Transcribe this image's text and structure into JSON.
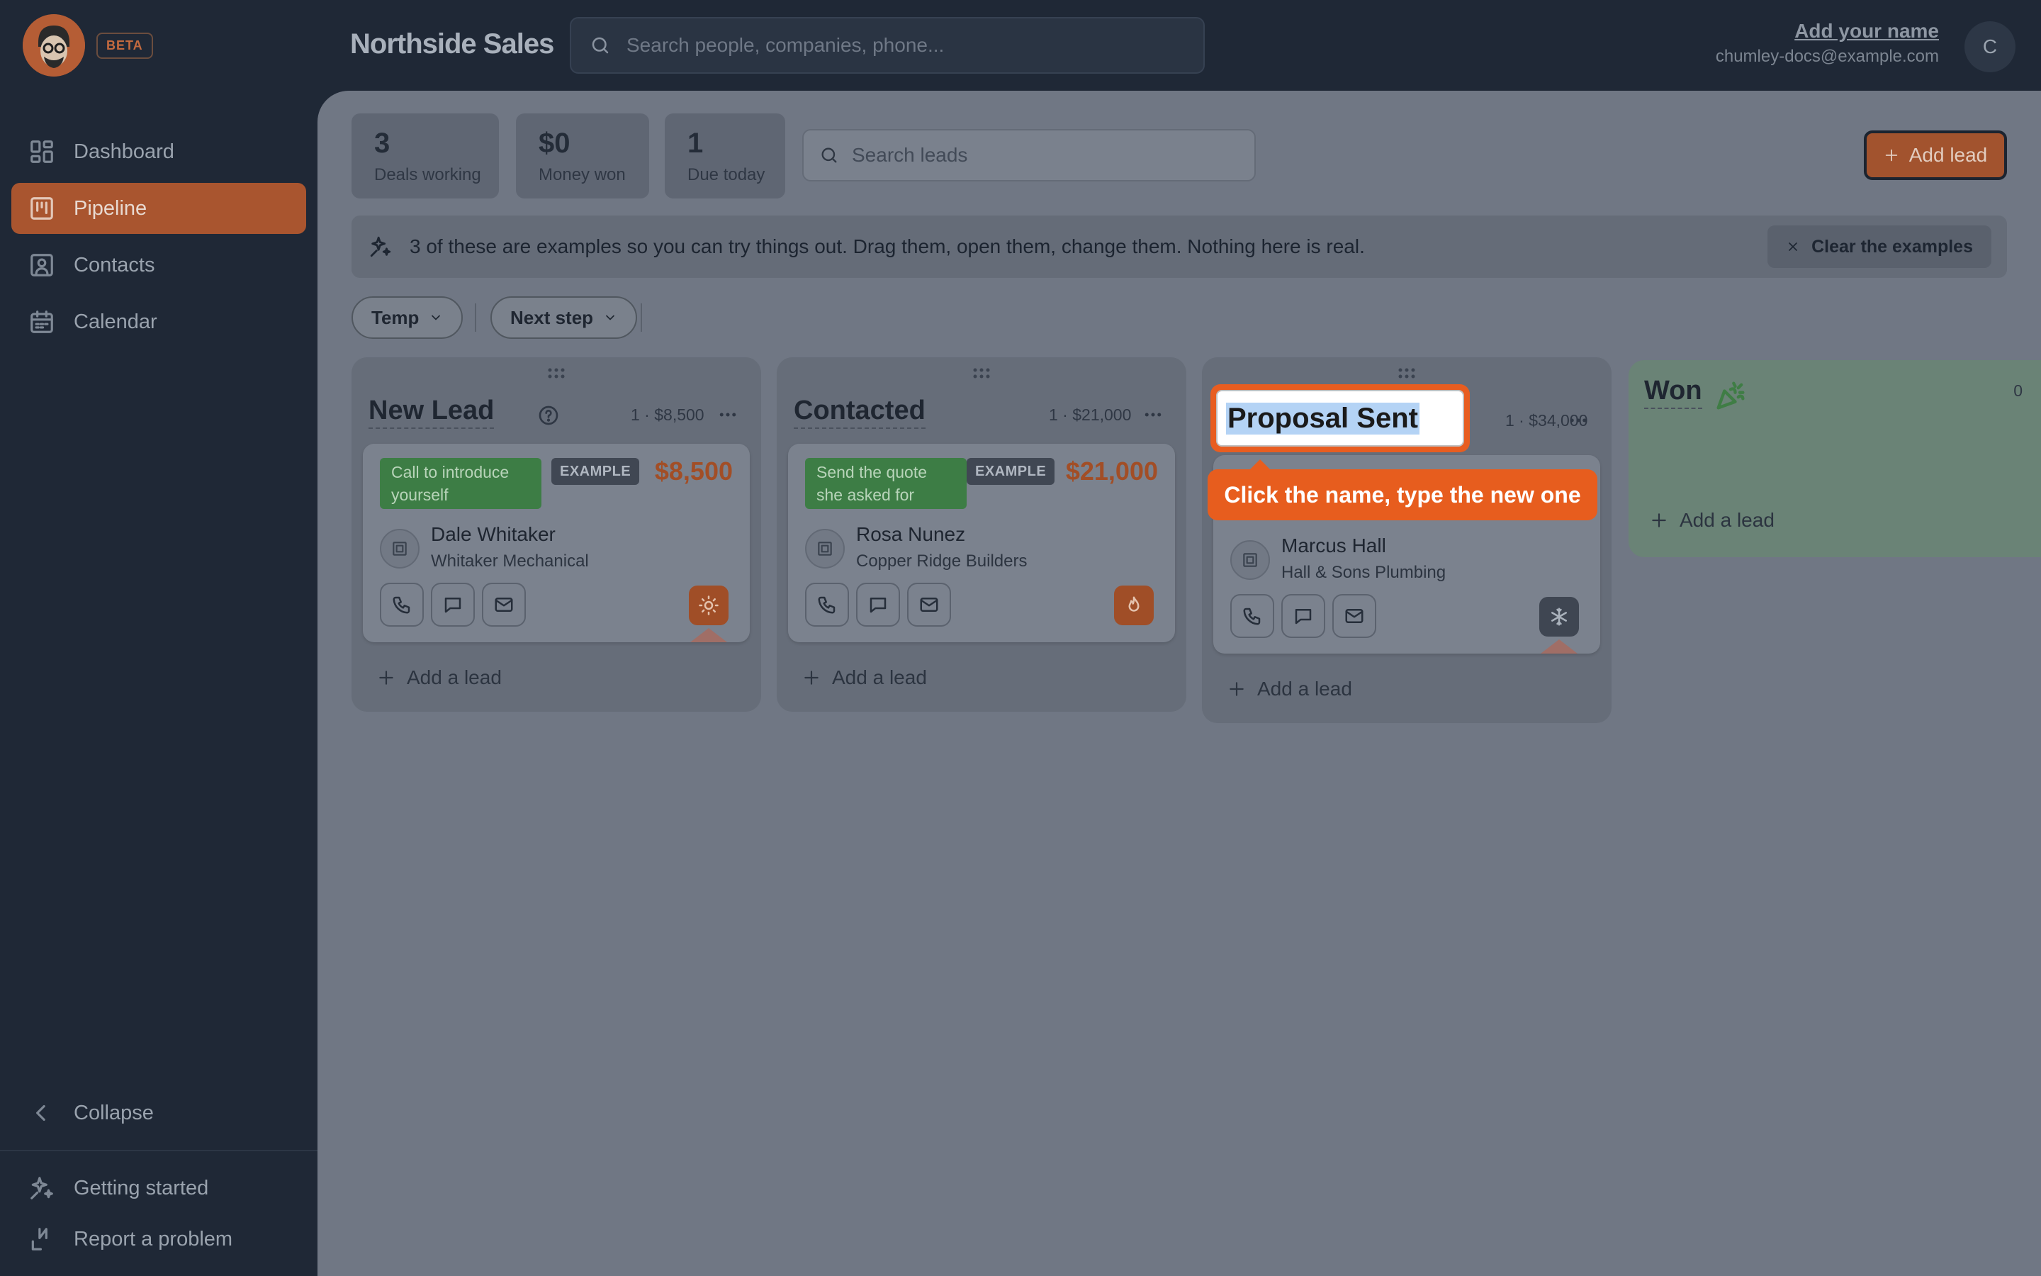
{
  "app": {
    "beta_label": "BETA",
    "title": "Northside Sales"
  },
  "header": {
    "search_placeholder": "Search people, companies, phone...",
    "user_name": "Add your name",
    "user_email": "chumley-docs@example.com",
    "avatar_initial": "C"
  },
  "sidebar": {
    "items": [
      {
        "label": "Dashboard",
        "icon": "dashboard-icon",
        "active": false
      },
      {
        "label": "Pipeline",
        "icon": "pipeline-icon",
        "active": true
      },
      {
        "label": "Contacts",
        "icon": "contacts-icon",
        "active": false
      },
      {
        "label": "Calendar",
        "icon": "calendar-icon",
        "active": false
      }
    ],
    "collapse_label": "Collapse",
    "getting_started_label": "Getting started",
    "report_label": "Report a problem"
  },
  "stats": [
    {
      "value": "3",
      "label": "Deals working"
    },
    {
      "value": "$0",
      "label": "Money won"
    },
    {
      "value": "1",
      "label": "Due today"
    }
  ],
  "leads_search_placeholder": "Search leads",
  "add_lead_label": "Add lead",
  "banner": {
    "text": "3 of these are examples so you can try things out. Drag them, open them, change them. Nothing here is real.",
    "clear_label": "Clear the examples"
  },
  "filters": [
    {
      "label": "Temp"
    },
    {
      "label": "Next step"
    }
  ],
  "columns": [
    {
      "title": "New Lead",
      "meta": "1 · $8,500",
      "add_label": "Add a lead",
      "card": {
        "next_step": "Call to introduce yourself",
        "badge": "EXAMPLE",
        "amount": "$8,500",
        "person": "Dale Whitaker",
        "company": "Whitaker Mechanical",
        "temperature": "warm",
        "temperature_icon": "sun-icon"
      }
    },
    {
      "title": "Contacted",
      "meta": "1 · $21,000",
      "add_label": "Add a lead",
      "card": {
        "next_step": "Send the quote she asked for",
        "badge": "EXAMPLE",
        "amount": "$21,000",
        "person": "Rosa Nunez",
        "company": "Copper Ridge Builders",
        "temperature": "hot",
        "temperature_icon": "flame-icon"
      }
    },
    {
      "title": "Proposal Sent",
      "meta": "1 · $34,000",
      "add_label": "Add a lead",
      "card": {
        "person": "Marcus Hall",
        "company": "Hall & Sons Plumbing",
        "temperature": "cold",
        "temperature_icon": "snowflake-icon"
      }
    },
    {
      "title": "Won",
      "meta": "0",
      "add_label": "Add a lead"
    }
  ],
  "rename": {
    "value": "Proposal Sent",
    "tooltip": "Click the name, type the new one"
  },
  "colors": {
    "accent": "#a9552f",
    "highlight": "#e85d20",
    "step_tag": "#3d7d45",
    "amount": "#a24e26"
  }
}
